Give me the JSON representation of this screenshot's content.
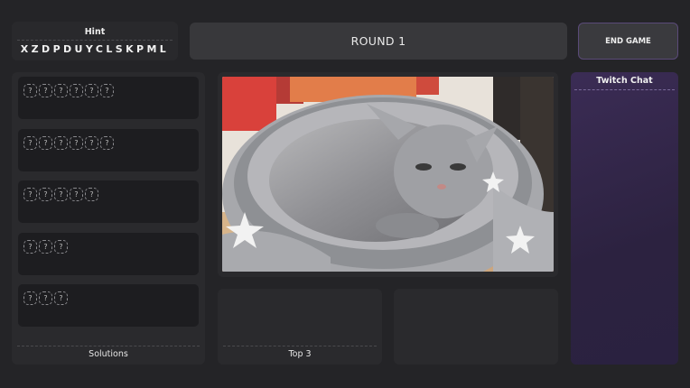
{
  "hint": {
    "title": "Hint",
    "letters": "XZDPDUYCLSKPML"
  },
  "round": {
    "label": "ROUND 1"
  },
  "end_game": {
    "label": "END GAME"
  },
  "solutions": {
    "rows": [
      {
        "slots": [
          "?",
          "?",
          "?",
          "?",
          "?",
          "?"
        ]
      },
      {
        "slots": [
          "?",
          "?",
          "?",
          "?",
          "?",
          "?"
        ]
      },
      {
        "slots": [
          "?",
          "?",
          "?",
          "?",
          "?"
        ]
      },
      {
        "slots": [
          "?",
          "?",
          "?"
        ]
      },
      {
        "slots": [
          "?",
          "?",
          "?"
        ]
      }
    ],
    "footer": "Solutions"
  },
  "top3": {
    "label": "Top 3"
  },
  "chat": {
    "title": "Twitch Chat"
  },
  "colors": {
    "background": "#242427",
    "panel": "#2a2a2d",
    "chat_accent": "#3b2c55"
  }
}
